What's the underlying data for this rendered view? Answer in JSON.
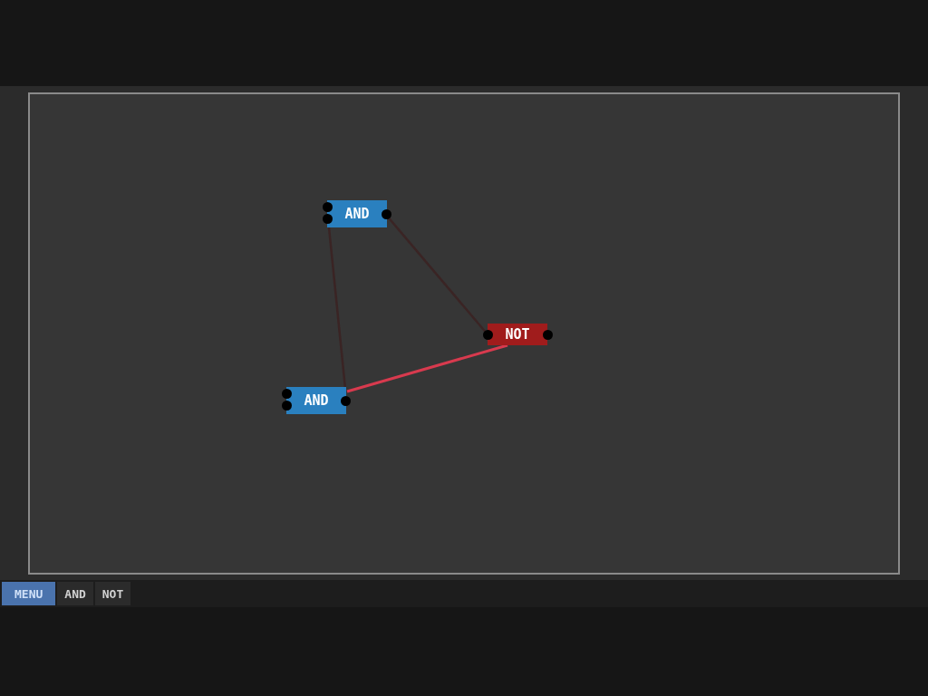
{
  "canvas": {
    "nodes": [
      {
        "kind": "and",
        "label": "AND"
      },
      {
        "kind": "not",
        "label": "NOT"
      },
      {
        "kind": "and",
        "label": "AND"
      }
    ],
    "wires": [
      {
        "active": false
      },
      {
        "active": false
      },
      {
        "active": true
      }
    ]
  },
  "toolbar": {
    "items": [
      {
        "label": "MENU",
        "selected": true
      },
      {
        "label": "AND",
        "selected": false
      },
      {
        "label": "NOT",
        "selected": false
      }
    ]
  }
}
